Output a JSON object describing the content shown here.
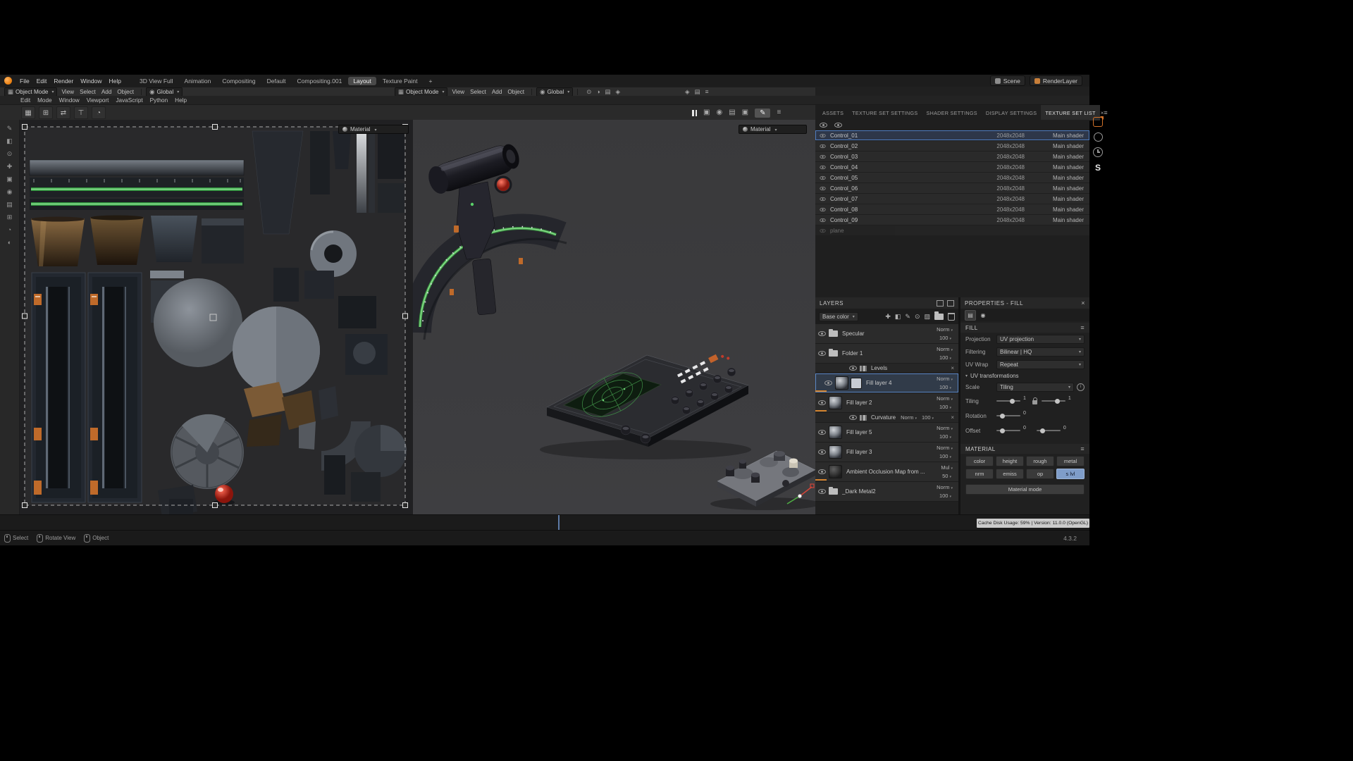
{
  "menubar": {
    "menus": [
      "File",
      "Edit",
      "Render",
      "Window",
      "Help"
    ],
    "workspaces": [
      {
        "label": "3D View Full"
      },
      {
        "label": "Animation"
      },
      {
        "label": "Compositing"
      },
      {
        "label": "Default"
      },
      {
        "label": "Compositing.001"
      },
      {
        "label": "Layout",
        "active": true
      },
      {
        "label": "Texture Paint"
      },
      {
        "label": "+"
      }
    ],
    "scene_label": "Scene",
    "render_layer_label": "RenderLayer"
  },
  "viewport_header": {
    "mode": "Object Mode",
    "menus": [
      "View",
      "Select",
      "Add",
      "Object"
    ],
    "orientation": "Global",
    "cluster1": [
      "⊙",
      "◑",
      "▤",
      "◈"
    ],
    "cluster2": [
      "◈",
      "▤",
      "≡"
    ]
  },
  "sp_menubar": {
    "menus": [
      "Edit",
      "Mode",
      "Window",
      "Viewport",
      "JavaScript",
      "Python",
      "Help"
    ]
  },
  "toolbar": {
    "left_tool_glyphs": [
      "▦",
      "⊞",
      "⇄",
      "⊤",
      "◔"
    ],
    "right_tool_glyphs": [
      "▣",
      "◉",
      "▤",
      "▣"
    ],
    "pencil_glyph": "✎",
    "menu_glyph": "≡"
  },
  "left_tools": {
    "glyphs": [
      "✎",
      "◧",
      "⊙",
      "✚",
      "▣",
      "◉",
      "▤",
      "⊞",
      "◔",
      "◐"
    ]
  },
  "panel_tabs": {
    "tabs": [
      {
        "label": "ASSETS"
      },
      {
        "label": "TEXTURE SET SETTINGS"
      },
      {
        "label": "SHADER SETTINGS"
      },
      {
        "label": "DISPLAY SETTINGS"
      },
      {
        "label": "TEXTURE SET LIST",
        "active": true
      }
    ],
    "close": "×"
  },
  "texture_set_list": {
    "rows": [
      {
        "name": "Control_01",
        "resolution": "2048x2048",
        "shader": "Main shader",
        "selected": true
      },
      {
        "name": "Control_02",
        "resolution": "2048x2048",
        "shader": "Main shader"
      },
      {
        "name": "Control_03",
        "resolution": "2048x2048",
        "shader": "Main shader"
      },
      {
        "name": "Control_04",
        "resolution": "2048x2048",
        "shader": "Main shader"
      },
      {
        "name": "Control_05",
        "resolution": "2048x2048",
        "shader": "Main shader"
      },
      {
        "name": "Control_06",
        "resolution": "2048x2048",
        "shader": "Main shader"
      },
      {
        "name": "Control_07",
        "resolution": "2048x2048",
        "shader": "Main shader"
      },
      {
        "name": "Control_08",
        "resolution": "2048x2048",
        "shader": "Main shader"
      },
      {
        "name": "Control_09",
        "resolution": "2048x2048",
        "shader": "Main shader"
      },
      {
        "name": "plane",
        "resolution": "",
        "shader": "",
        "disabled": true
      }
    ]
  },
  "uv_edit": {
    "material": "Material"
  },
  "view3d": {
    "material": "Material"
  },
  "layers": {
    "title": "LAYERS",
    "channel": "Base color",
    "rows": [
      {
        "name": "Specular",
        "blend": "Norm",
        "opacity": "100",
        "folder": true
      },
      {
        "name": "Folder 1",
        "blend": "Norm",
        "opacity": "100",
        "folder": true
      },
      {
        "name": "Levels",
        "blend": "",
        "opacity": "",
        "effect": true,
        "indent": true,
        "close": "×"
      },
      {
        "name": "Fill layer 4",
        "blend": "Norm",
        "opacity": "100",
        "indent": true,
        "selected": true,
        "accent": true,
        "extra": true
      },
      {
        "name": "Fill layer 2",
        "blend": "Norm",
        "opacity": "100",
        "accent": true
      },
      {
        "name": "Curvature",
        "blend": "Norm",
        "opacity": "100",
        "effect": true,
        "indent": true,
        "close": "×"
      },
      {
        "name": "Fill layer 5",
        "blend": "Norm",
        "opacity": "100"
      },
      {
        "name": "Fill layer 3",
        "blend": "Norm",
        "opacity": "100"
      },
      {
        "name": "Ambient Occlusion Map from ...",
        "blend": "Mul",
        "opacity": "50",
        "dark": true,
        "accent": true
      },
      {
        "name": "_Dark Metal2",
        "blend": "Norm",
        "opacity": "100",
        "folder": true
      }
    ]
  },
  "properties": {
    "title": "PROPERTIES - FILL",
    "close": "×",
    "section_fill": "FILL",
    "projection_label": "Projection",
    "projection_value": "UV projection",
    "filtering_label": "Filtering",
    "filtering_value": "Bilinear | HQ",
    "uv_wrap_label": "UV Wrap",
    "uv_wrap_value": "Repeat",
    "uv_transformations": "UV transformations",
    "scale_label": "Scale",
    "scale_value": "Tiling",
    "tiling_label": "Tiling",
    "tiling_value1": "1",
    "tiling_value2": "1",
    "rotation_label": "Rotation",
    "rotation_value": "0",
    "offset_label": "Offset",
    "offset_value1": "0",
    "offset_value2": "0",
    "section_material": "MATERIAL",
    "channels": [
      {
        "label": "color"
      },
      {
        "label": "height"
      },
      {
        "label": "rough"
      },
      {
        "label": "metal"
      },
      {
        "label": "nrm"
      },
      {
        "label": "emiss"
      },
      {
        "label": "op"
      },
      {
        "label": "s lvl",
        "active": true
      }
    ],
    "material_mode": "Material mode"
  },
  "footer": {
    "cache_info": "Cache Disk Usage:    59% | Version: 11.0.0 (OpenGL)",
    "hints": [
      {
        "label": "Select"
      },
      {
        "label": "Rotate View"
      },
      {
        "label": "Object"
      }
    ],
    "version": "4.3.2"
  },
  "side_strip": {
    "s_logo": "S"
  }
}
